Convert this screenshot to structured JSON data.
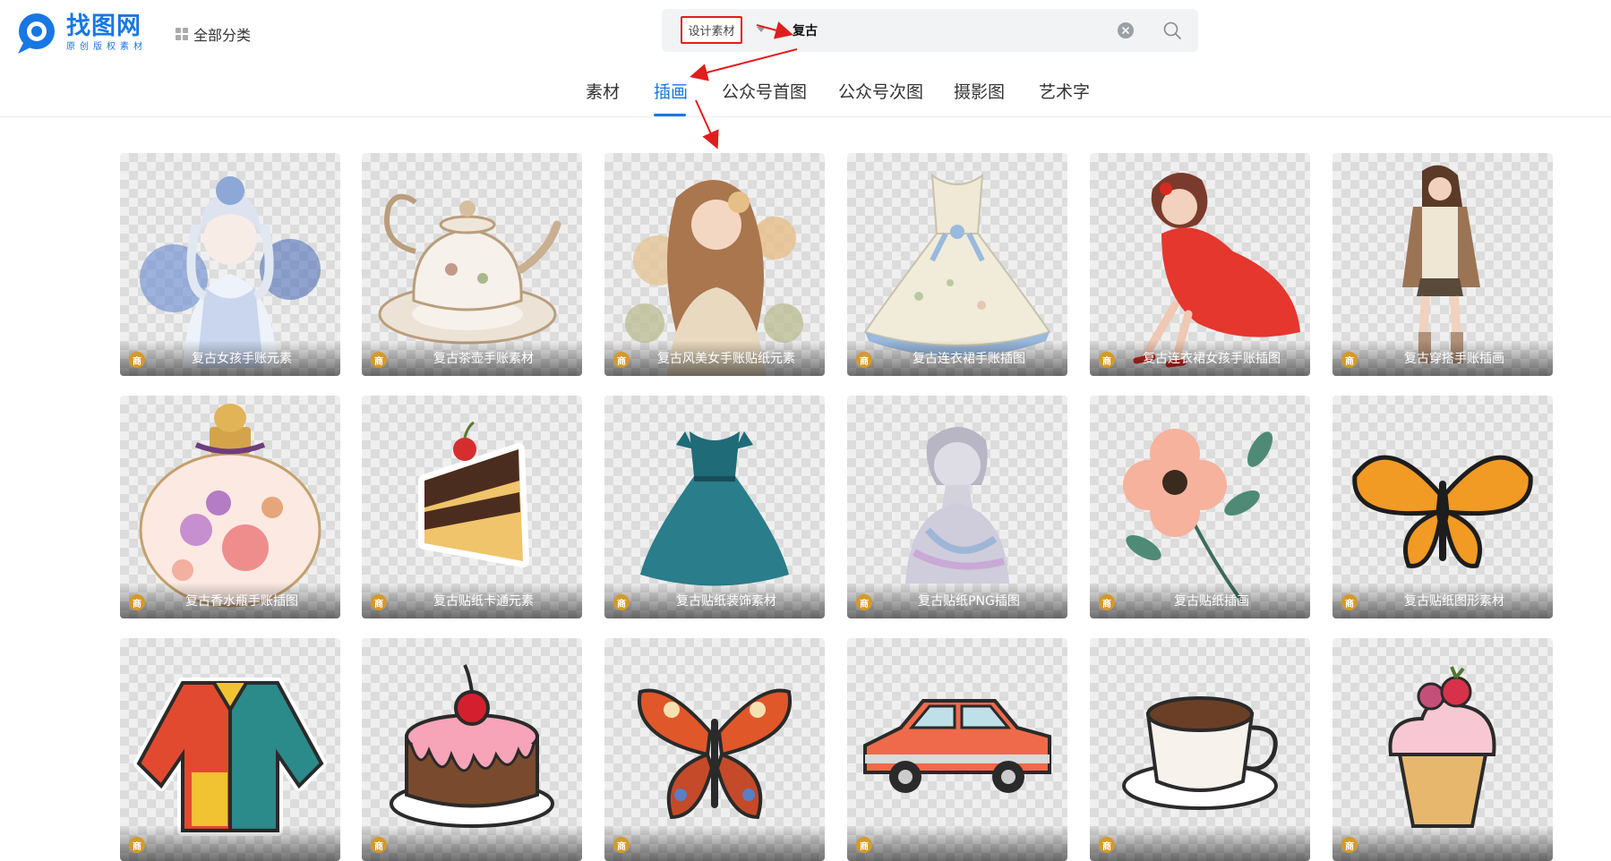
{
  "logo": {
    "title": "找图网",
    "subtitle": "原创版权素材"
  },
  "header": {
    "categories_label": "全部分类"
  },
  "search": {
    "scope": "设计素材",
    "query": "复古"
  },
  "tabs": [
    {
      "label": "素材"
    },
    {
      "label": "插画",
      "active": true
    },
    {
      "label": "公众号首图"
    },
    {
      "label": "公众号次图"
    },
    {
      "label": "摄影图"
    },
    {
      "label": "艺术字"
    }
  ],
  "badge_text": "商",
  "colors": {
    "brand": "#1777e4",
    "annotation": "#e01e1e",
    "badge": "#d49a2a"
  },
  "cards": [
    {
      "title": "复古女孩手账元素",
      "icon": "girl-illustration"
    },
    {
      "title": "复古茶壶手账素材",
      "icon": "teapot-illustration"
    },
    {
      "title": "复古风美女手账贴纸元素",
      "icon": "woman-illustration"
    },
    {
      "title": "复古连衣裙手账插图",
      "icon": "dress-illustration"
    },
    {
      "title": "复古连衣裙女孩手账插图",
      "icon": "red-dress-girl-illustration"
    },
    {
      "title": "复古穿搭手账插画",
      "icon": "outfit-illustration"
    },
    {
      "title": "复古香水瓶手账插图",
      "icon": "perfume-bottle-illustration"
    },
    {
      "title": "复古贴纸卡通元素",
      "icon": "cake-slice-illustration"
    },
    {
      "title": "复古贴纸装饰素材",
      "icon": "teal-dress-illustration"
    },
    {
      "title": "复古贴纸PNG插图",
      "icon": "statue-illustration"
    },
    {
      "title": "复古贴纸插画",
      "icon": "flower-illustration"
    },
    {
      "title": "复古贴纸图形素材",
      "icon": "butterfly-illustration"
    },
    {
      "title": "",
      "icon": "jacket-illustration"
    },
    {
      "title": "",
      "icon": "cake-illustration"
    },
    {
      "title": "",
      "icon": "butterfly-illustration"
    },
    {
      "title": "",
      "icon": "car-illustration"
    },
    {
      "title": "",
      "icon": "coffee-cup-illustration"
    },
    {
      "title": "",
      "icon": "cupcake-illustration"
    }
  ]
}
